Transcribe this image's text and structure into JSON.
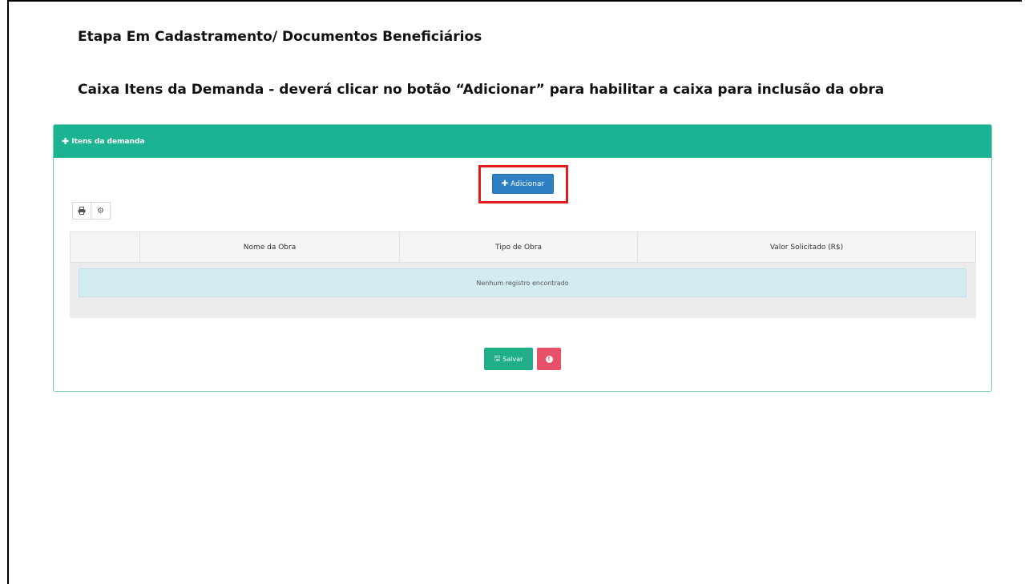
{
  "slide": {
    "title_1": "Etapa Em Cadastramento/ Documentos Beneficiários",
    "title_2": "Caixa Itens da Demanda - deverá clicar no botão “Adicionar” para habilitar a caixa para inclusão da obra"
  },
  "panel": {
    "header_label": "Itens da demanda",
    "header_icon": "plus-icon",
    "accent_color": "#1cb392",
    "add_button_label": "Adicionar",
    "add_button_color": "#2d80c4",
    "highlight_color": "#e21b1b",
    "toolbar_icons": [
      "print-icon",
      "gear-icon"
    ],
    "table": {
      "columns": [
        "",
        "Nome da Obra",
        "Tipo de Obra",
        "Valor Solicitado (R$)"
      ],
      "empty_message": "Nenhum registro encontrado"
    },
    "save_button_label": "Salvar",
    "save_button_color": "#1fae88",
    "info_button_color": "#e8506a"
  }
}
